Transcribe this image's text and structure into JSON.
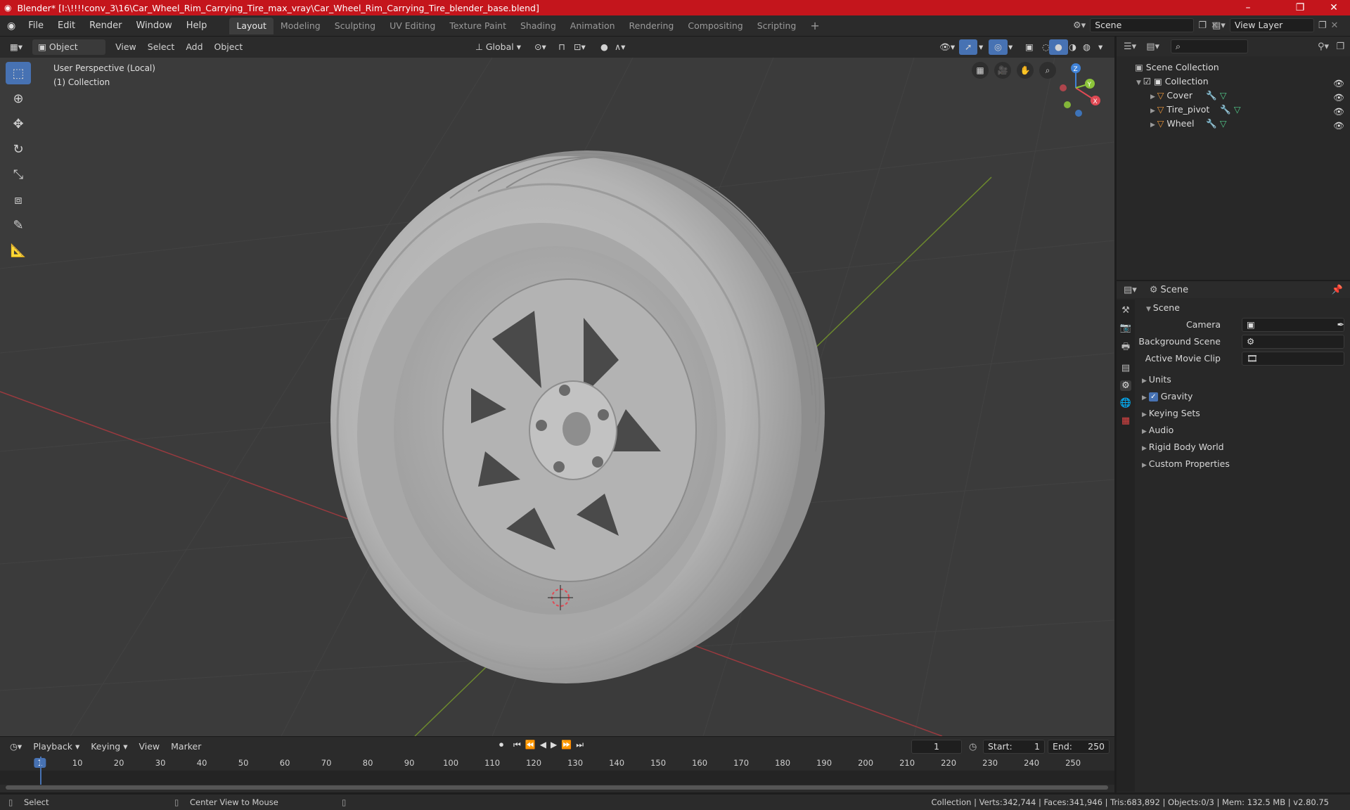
{
  "window": {
    "title": "Blender* [I:\\!!!!conv_3\\16\\Car_Wheel_Rim_Carrying_Tire_max_vray\\Car_Wheel_Rim_Carrying_Tire_blender_base.blend]",
    "minimize": "–",
    "maximize": "❐",
    "close": "✕"
  },
  "menubar": {
    "items": [
      "File",
      "Edit",
      "Render",
      "Window",
      "Help"
    ]
  },
  "workspaces": {
    "tabs": [
      "Layout",
      "Modeling",
      "Sculpting",
      "UV Editing",
      "Texture Paint",
      "Shading",
      "Animation",
      "Rendering",
      "Compositing",
      "Scripting"
    ],
    "active": "Layout",
    "add": "+"
  },
  "scene_selector": {
    "value": "Scene"
  },
  "viewlayer_selector": {
    "value": "View Layer"
  },
  "viewport_header": {
    "mode": "Object Mode",
    "menus": [
      "View",
      "Select",
      "Add",
      "Object"
    ],
    "orientation": "Global"
  },
  "viewport": {
    "overlay_line1": "User Perspective (Local)",
    "overlay_line2": "(1) Collection",
    "gizmo": {
      "x": "X",
      "y": "Y",
      "z": "Z"
    }
  },
  "outliner": {
    "root": "Scene Collection",
    "collection": "Collection",
    "objects": [
      "Cover",
      "Tire_pivot",
      "Wheel"
    ]
  },
  "properties": {
    "header": "Scene",
    "panel_title": "Scene",
    "fields": [
      {
        "label": "Camera",
        "value": ""
      },
      {
        "label": "Background Scene",
        "value": ""
      },
      {
        "label": "Active Movie Clip",
        "value": ""
      }
    ],
    "sections": [
      "Units",
      "Gravity",
      "Keying Sets",
      "Audio",
      "Rigid Body World",
      "Custom Properties"
    ],
    "gravity_checked": true
  },
  "timeline": {
    "menus": [
      "Playback",
      "Keying",
      "View",
      "Marker"
    ],
    "current_frame": "1",
    "start_label": "Start:",
    "start_value": "1",
    "end_label": "End:",
    "end_value": "250",
    "ruler": [
      "1",
      "10",
      "20",
      "30",
      "40",
      "50",
      "60",
      "70",
      "80",
      "90",
      "100",
      "110",
      "120",
      "130",
      "140",
      "150",
      "160",
      "170",
      "180",
      "190",
      "200",
      "210",
      "220",
      "230",
      "240",
      "250"
    ]
  },
  "statusbar": {
    "left": "Select",
    "middle": "Center View to Mouse",
    "right": "Collection | Verts:342,744 | Faces:341,946 | Tris:683,892 | Objects:0/3 | Mem: 132.5 MB | v2.80.75"
  },
  "colors": {
    "titlebar": "#c4151c",
    "accent": "#4772b3",
    "x_axis": "#e04a54",
    "y_axis": "#8cc43a",
    "z_axis": "#3f82d8",
    "object_icon": "#e8953a",
    "modifier_icon": "#7ca8e8",
    "mesh_icon": "#52c98a"
  },
  "icons": [
    "blender-logo-icon",
    "cursor-icon",
    "move-icon",
    "rotate-icon",
    "scale-icon",
    "transform-icon",
    "annotate-icon",
    "measure-icon",
    "eye-icon",
    "camera-icon",
    "hand-icon",
    "zoom-icon",
    "filter-icon",
    "search-icon",
    "pin-icon",
    "play-icon"
  ]
}
